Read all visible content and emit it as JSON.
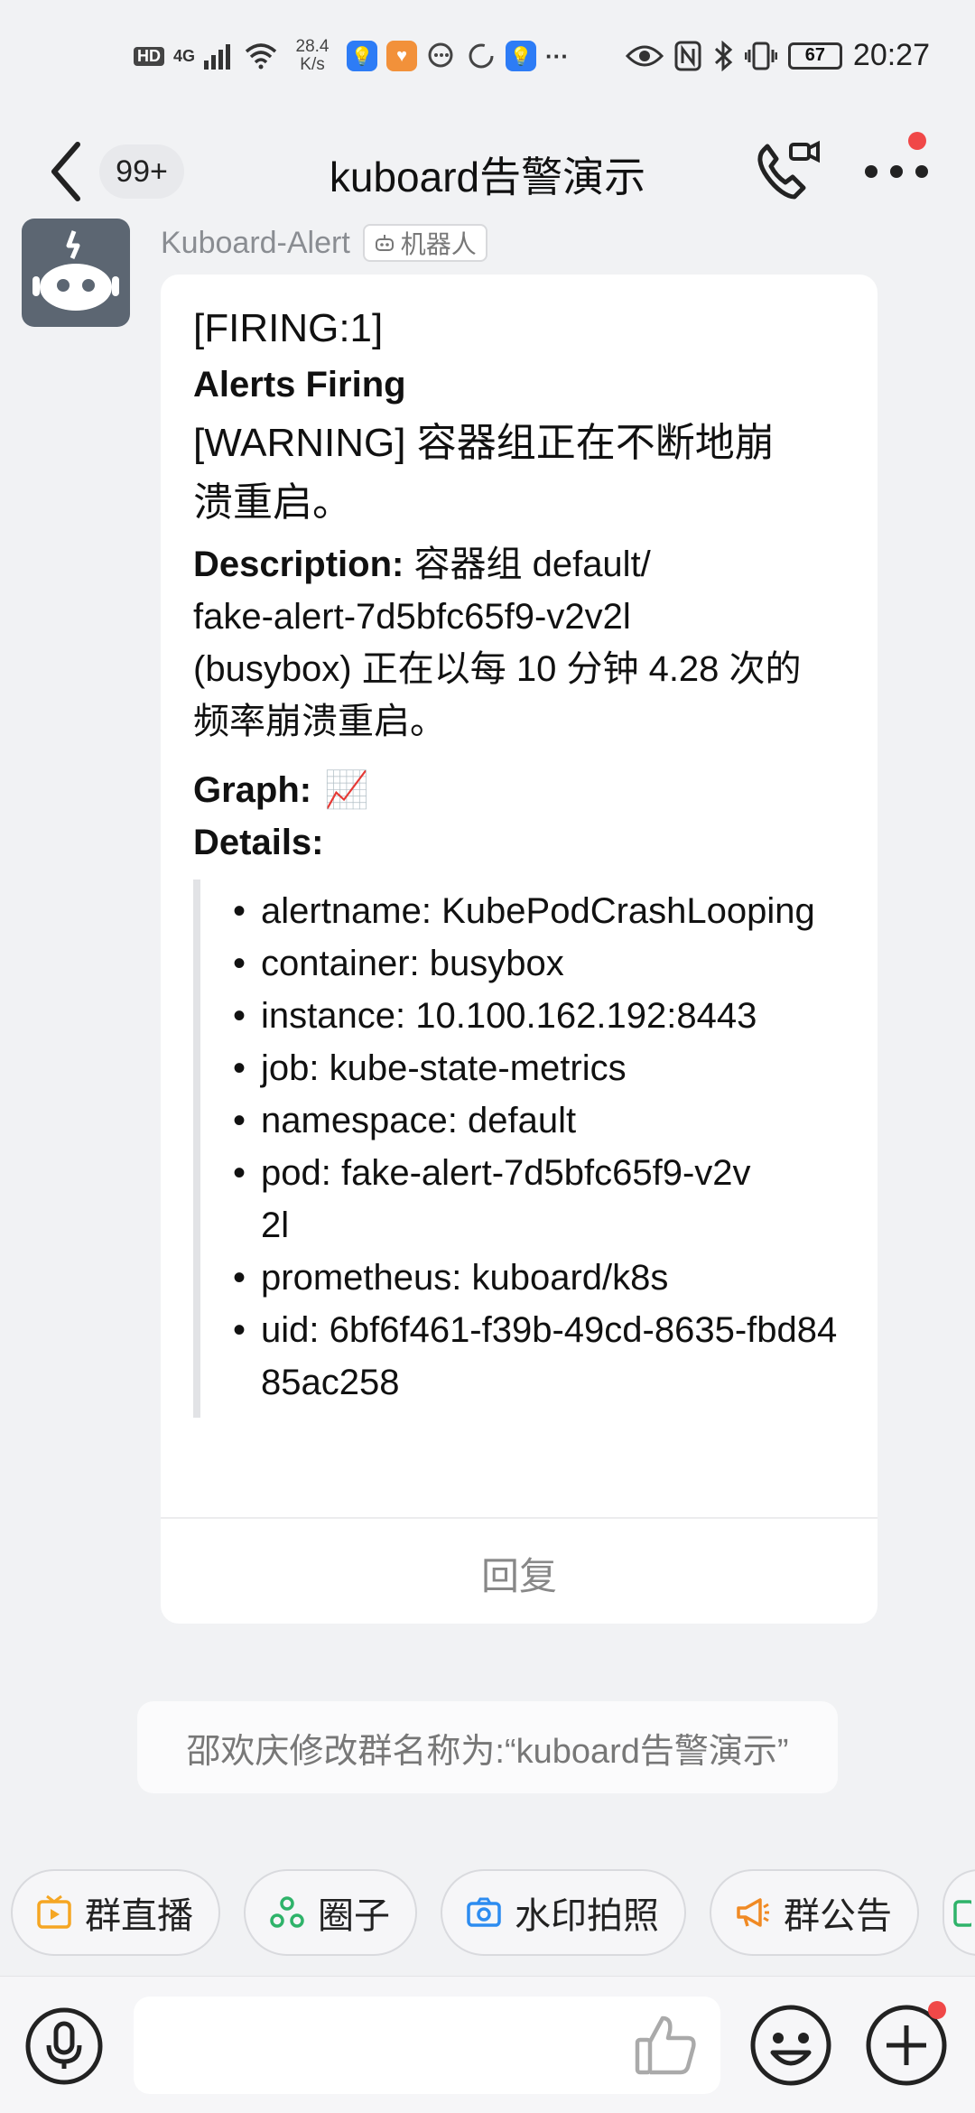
{
  "status_bar": {
    "hd": "HD",
    "net_type": "4G",
    "net_speed_value": "28.4",
    "net_speed_unit": "K/s",
    "more": "···",
    "battery": "67",
    "time": "20:27"
  },
  "header": {
    "unread_badge": "99+",
    "title": "kuboard告警演示"
  },
  "message": {
    "sender_name": "Kuboard-Alert",
    "sender_tag": "机器人",
    "firing": "[FIRING:1]",
    "alerts_heading": "Alerts Firing",
    "warning_line1": "[WARNING] 容器组正在不断地崩",
    "warning_line2": "溃重启。",
    "description_label": "Description:",
    "description_l1": " 容器组 default/",
    "description_l2": "fake-alert-7d5bfc65f9-v2v2l",
    "description_l3": "(busybox) 正在以每 10 分钟 4.28 次的",
    "description_l4": "频率崩溃重启。",
    "graph_label": "Graph:",
    "graph_icon": "📈",
    "details_label": "Details:",
    "details": [
      "alertname: KubePodCrashLooping",
      "container: busybox",
      "instance: 10.100.162.192:8443",
      "job: kube-state-metrics",
      "namespace: default",
      "pod: fake-alert-7d5bfc65f9-v2v2l",
      "prometheus: kuboard/k8s",
      "uid: 6bf6f461-f39b-49cd-8635-fbd8485ac258"
    ],
    "reply": "回复"
  },
  "system_message": "邵欢庆修改群名称为:“kuboard告警演示”",
  "quick_actions": [
    {
      "label": "群直播",
      "icon": "tv-icon",
      "color": "#f5a623"
    },
    {
      "label": "圈子",
      "icon": "circle-group-icon",
      "color": "#2fb36a"
    },
    {
      "label": "水印拍照",
      "icon": "camera-icon",
      "color": "#2d8cf0"
    },
    {
      "label": "群公告",
      "icon": "megaphone-icon",
      "color": "#f08a24"
    }
  ],
  "colors": {
    "accent_red": "#f04848",
    "background": "#f1f2f4"
  }
}
